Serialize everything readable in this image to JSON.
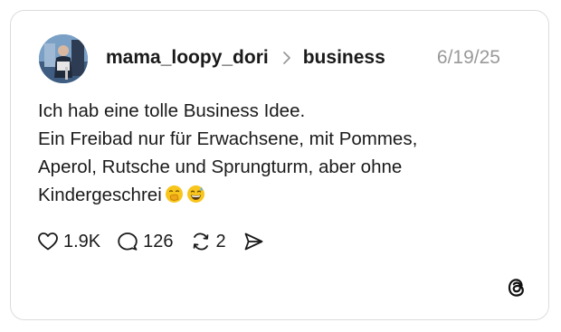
{
  "post": {
    "author": "mama_loopy_dori",
    "community": "business",
    "date": "6/19/25",
    "text_lines": [
      "Ich hab eine tolle Business Idee.",
      "Ein Freibad nur für Erwachsene, mit Pommes,",
      "Aperol,  Rutsche und Sprungturm, aber ohne",
      "Kindergeschrei"
    ],
    "emojis": [
      "hand-over-mouth-emoji",
      "grinning-sweat-emoji"
    ]
  },
  "actions": {
    "likes": "1.9K",
    "replies": "126",
    "reposts": "2"
  },
  "icons": {
    "like": "heart-icon",
    "reply": "speech-bubble-icon",
    "repost": "repost-arrows-icon",
    "share": "send-icon",
    "logo": "threads-logo-icon"
  },
  "colors": {
    "text": "#1a1a1a",
    "muted": "#999999",
    "border": "#dcdcdc",
    "background": "#ffffff"
  }
}
